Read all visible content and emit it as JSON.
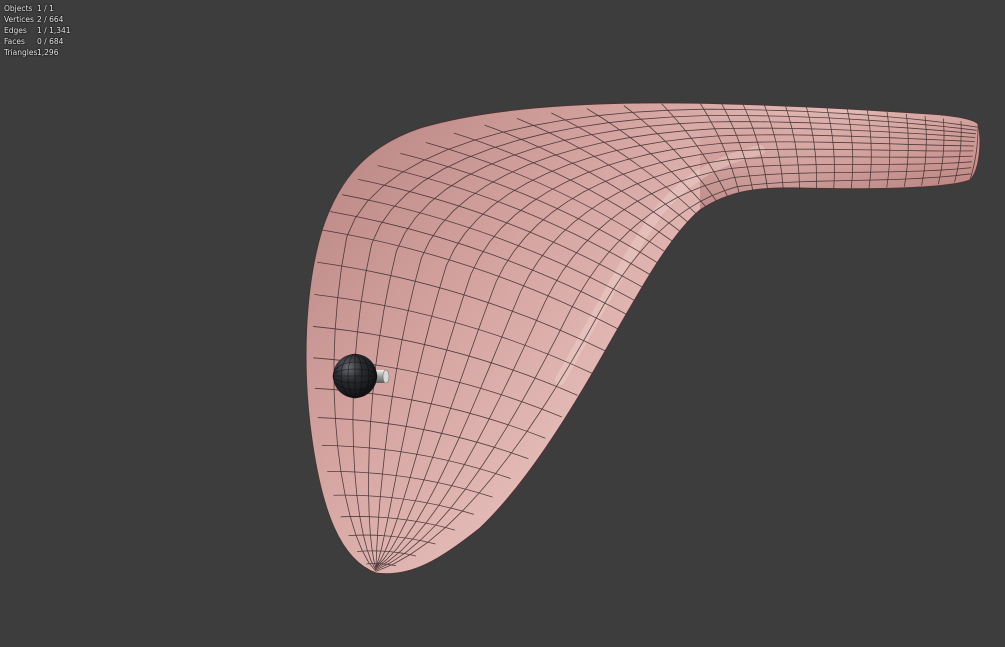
{
  "stats": [
    {
      "label": "Objects",
      "value": "1 / 1"
    },
    {
      "label": "Vertices",
      "value": "2 / 664"
    },
    {
      "label": "Edges",
      "value": "1 / 1,341"
    },
    {
      "label": "Faces",
      "value": "0 / 684"
    },
    {
      "label": "Triangles",
      "value": "1,296"
    }
  ],
  "colors": {
    "background": "#3d3d3d",
    "mesh_surface": "#c79592",
    "mesh_highlight": "#ebc9c5",
    "mesh_shadow": "#9d6c6b",
    "wireframe": "#3a2a2a",
    "sphere": "#1e1f22"
  },
  "scene": {
    "object": "mesh-object",
    "selection": "sphere-gizmo"
  }
}
